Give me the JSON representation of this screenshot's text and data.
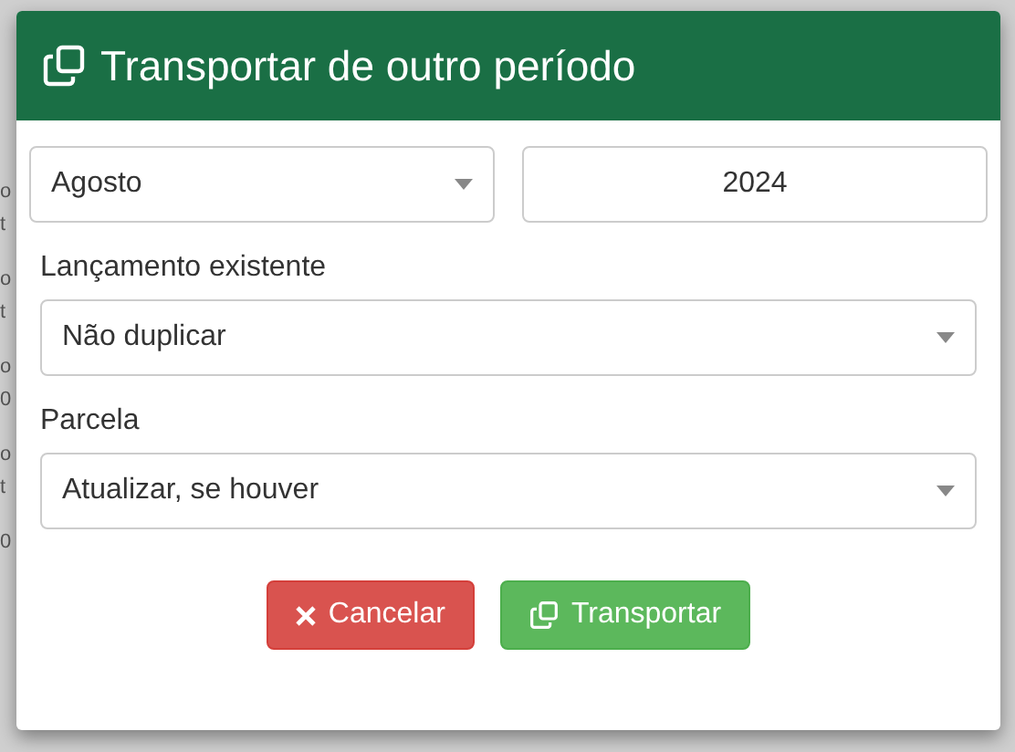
{
  "background_fragments": [
    "o",
    "t",
    "o",
    "t",
    "o",
    "0",
    "o",
    "t",
    "0"
  ],
  "dialog": {
    "title": "Transportar de outro período",
    "month": {
      "value": "Agosto"
    },
    "year": {
      "value": "2024"
    },
    "fields": [
      {
        "label": "Lançamento existente",
        "value": "Não duplicar"
      },
      {
        "label": "Parcela",
        "value": "Atualizar, se houver"
      }
    ],
    "buttons": [
      {
        "kind": "cancel",
        "label": "Cancelar"
      },
      {
        "kind": "confirm",
        "label": "Transportar"
      }
    ]
  }
}
